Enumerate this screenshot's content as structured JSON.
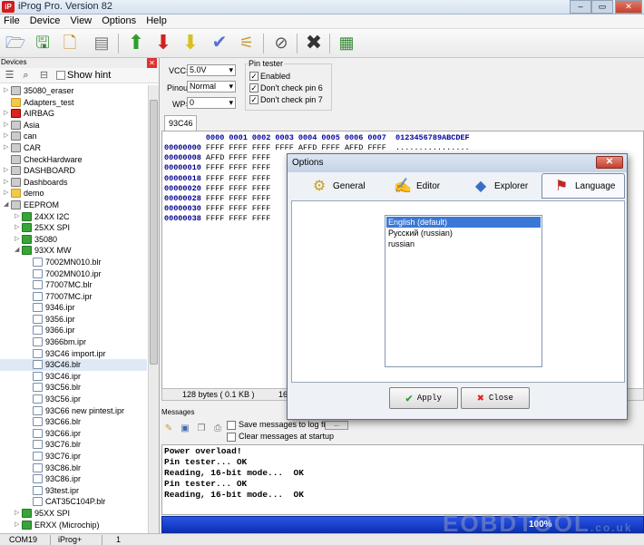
{
  "app": {
    "title": "iProg Pro. Version 82",
    "icon_label": "iP"
  },
  "window_controls": {
    "minimize": "–",
    "maximize": "▭",
    "close": "✕"
  },
  "menu": [
    "File",
    "Device",
    "View",
    "Options",
    "Help"
  ],
  "toolbar": {
    "icons": [
      "open-icon",
      "save-icon",
      "new-icon",
      "read-icon",
      "write-up-icon",
      "erase-down-icon",
      "verify-down-icon",
      "check-icon",
      "clear-icon",
      "stop-icon",
      "cancel-icon",
      "calculator-icon"
    ]
  },
  "devices": {
    "header": "Devices",
    "close": "✕",
    "show_hint": "Show hint",
    "tree": [
      {
        "label": "35080_eraser",
        "icon": "gray",
        "toggle": "▷",
        "indent": 0
      },
      {
        "label": "Adapters_test",
        "icon": "folder",
        "toggle": "",
        "indent": 0
      },
      {
        "label": "AIRBAG",
        "icon": "red",
        "toggle": "▷",
        "indent": 0
      },
      {
        "label": "Asia",
        "icon": "gray",
        "toggle": "▷",
        "indent": 0
      },
      {
        "label": "can",
        "icon": "gray",
        "toggle": "▷",
        "indent": 0
      },
      {
        "label": "CAR",
        "icon": "gray",
        "toggle": "▷",
        "indent": 0
      },
      {
        "label": "CheckHardware",
        "icon": "gray",
        "toggle": "",
        "indent": 0
      },
      {
        "label": "DASHBOARD",
        "icon": "gray",
        "toggle": "▷",
        "indent": 0
      },
      {
        "label": "Dashboards",
        "icon": "gray",
        "toggle": "▷",
        "indent": 0
      },
      {
        "label": "demo",
        "icon": "folder",
        "toggle": "▷",
        "indent": 0
      },
      {
        "label": "EEPROM",
        "icon": "gray",
        "toggle": "◢",
        "indent": 0
      },
      {
        "label": "24XX I2C",
        "icon": "chip",
        "toggle": "▷",
        "indent": 1
      },
      {
        "label": "25XX SPI",
        "icon": "chip",
        "toggle": "▷",
        "indent": 1
      },
      {
        "label": "35080",
        "icon": "chip",
        "toggle": "▷",
        "indent": 1
      },
      {
        "label": "93XX MW",
        "icon": "chip",
        "toggle": "◢",
        "indent": 1
      },
      {
        "label": "7002MN010.blr",
        "icon": "file",
        "toggle": "",
        "indent": 2
      },
      {
        "label": "7002MN010.ipr",
        "icon": "file",
        "toggle": "",
        "indent": 2
      },
      {
        "label": "77007MC.blr",
        "icon": "file",
        "toggle": "",
        "indent": 2
      },
      {
        "label": "77007MC.ipr",
        "icon": "file",
        "toggle": "",
        "indent": 2
      },
      {
        "label": "9346.ipr",
        "icon": "file",
        "toggle": "",
        "indent": 2
      },
      {
        "label": "9356.ipr",
        "icon": "file",
        "toggle": "",
        "indent": 2
      },
      {
        "label": "9366.ipr",
        "icon": "file",
        "toggle": "",
        "indent": 2
      },
      {
        "label": "9366bm.ipr",
        "icon": "file",
        "toggle": "",
        "indent": 2
      },
      {
        "label": "93C46 import.ipr",
        "icon": "file",
        "toggle": "",
        "indent": 2
      },
      {
        "label": "93C46.blr",
        "icon": "file",
        "toggle": "",
        "indent": 2,
        "selected": true
      },
      {
        "label": "93C46.ipr",
        "icon": "file",
        "toggle": "",
        "indent": 2
      },
      {
        "label": "93C56.blr",
        "icon": "file",
        "toggle": "",
        "indent": 2
      },
      {
        "label": "93C56.ipr",
        "icon": "file",
        "toggle": "",
        "indent": 2
      },
      {
        "label": "93C66 new pintest.ipr",
        "icon": "file",
        "toggle": "",
        "indent": 2
      },
      {
        "label": "93C66.blr",
        "icon": "file",
        "toggle": "",
        "indent": 2
      },
      {
        "label": "93C66.ipr",
        "icon": "file",
        "toggle": "",
        "indent": 2
      },
      {
        "label": "93C76.blr",
        "icon": "file",
        "toggle": "",
        "indent": 2
      },
      {
        "label": "93C76.ipr",
        "icon": "file",
        "toggle": "",
        "indent": 2
      },
      {
        "label": "93C86.blr",
        "icon": "file",
        "toggle": "",
        "indent": 2
      },
      {
        "label": "93C86.ipr",
        "icon": "file",
        "toggle": "",
        "indent": 2
      },
      {
        "label": "93test.ipr",
        "icon": "file",
        "toggle": "",
        "indent": 2
      },
      {
        "label": "CAT35C104P.blr",
        "icon": "file",
        "toggle": "",
        "indent": 2
      },
      {
        "label": "95XX SPI",
        "icon": "chip",
        "toggle": "▷",
        "indent": 1
      },
      {
        "label": "ERXX (Microchip)",
        "icon": "chip",
        "toggle": "▷",
        "indent": 1
      }
    ]
  },
  "settings": {
    "vcc_label": "VCC=",
    "vcc_value": "5.0V",
    "pinout_label": "Pinout",
    "pinout_value": "Normal",
    "wp_label": "WP=",
    "wp_value": "0",
    "pin_tester_title": "Pin tester",
    "enabled": "Enabled",
    "pin6": "Don't check pin 6",
    "pin7": "Don't check pin 7",
    "check_mark": "✓"
  },
  "hex": {
    "tab": "93C46",
    "header": "         0000 0001 0002 0003 0004 0005 0006 0007  0123456789ABCDEF",
    "rows": [
      {
        "addr": "00000000",
        "data": " FFFF FFFF FFFF FFFF AFFD FFFF AFFD FFFF  ................"
      },
      {
        "addr": "00000008",
        "data": " AFFD FFFF FFFF"
      },
      {
        "addr": "00000010",
        "data": " FFFF FFFF FFFF"
      },
      {
        "addr": "00000018",
        "data": " FFFF FFFF FFFF"
      },
      {
        "addr": "00000020",
        "data": " FFFF FFFF FFFF"
      },
      {
        "addr": "00000028",
        "data": " FFFF FFFF FFFF"
      },
      {
        "addr": "00000030",
        "data": " FFFF FFFF FFFF"
      },
      {
        "addr": "00000038",
        "data": " FFFF FFFF FFFF"
      }
    ],
    "status_size": "128 bytes ( 0.1 KB )",
    "status_part": "16"
  },
  "messages": {
    "header": "Messages",
    "save_log": "Save messages to log fi",
    "browse": "...",
    "clear_startup": "Clear messages at startup",
    "lines": [
      "Power overload!",
      "Pin tester... OK",
      "Reading, 16-bit mode...  OK",
      "Pin tester... OK",
      "Reading, 16-bit mode...  OK"
    ]
  },
  "progress": {
    "value": 1.0,
    "label": "100%"
  },
  "watermark": {
    "main": "EOBDTOOL",
    "suffix": ".co.uk"
  },
  "statusbar": {
    "port": "COM19",
    "device": "iProg+",
    "count": "1"
  },
  "dialog": {
    "title": "Options",
    "close": "✕",
    "tabs": [
      {
        "label": "General",
        "icon": "gears-icon"
      },
      {
        "label": "Editor",
        "icon": "editor-icon"
      },
      {
        "label": "Explorer",
        "icon": "explorer-icon"
      },
      {
        "label": "Language",
        "icon": "flag-icon"
      }
    ],
    "languages": [
      "English (default)",
      "Русский (russian)",
      "russian"
    ],
    "selected_language": "English (default)",
    "apply": "Apply",
    "close_btn": "Close"
  }
}
